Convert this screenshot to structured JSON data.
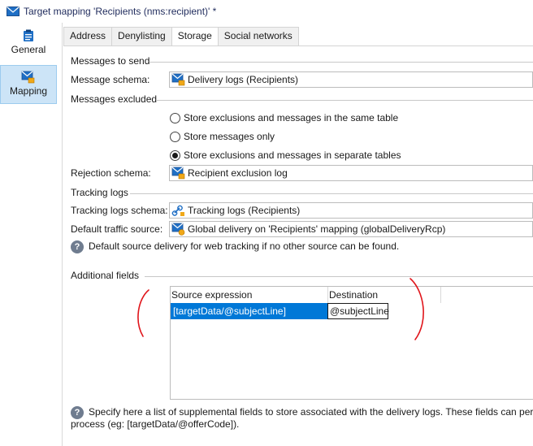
{
  "window": {
    "title": "Target mapping 'Recipients (nms:recipient)' *"
  },
  "nav": {
    "items": [
      {
        "label": "General",
        "icon": "clipboard-icon"
      },
      {
        "label": "Mapping",
        "icon": "mapping-icon",
        "selected": true
      }
    ]
  },
  "tabs": [
    {
      "label": "Address"
    },
    {
      "label": "Denylisting"
    },
    {
      "label": "Storage",
      "active": true
    },
    {
      "label": "Social networks"
    }
  ],
  "storage": {
    "messages_to_send": {
      "section_title": "Messages to send",
      "schema_label": "Message schema:",
      "schema_value": "Delivery logs (Recipients)"
    },
    "messages_excluded": {
      "section_title": "Messages excluded",
      "options": [
        {
          "label": "Store exclusions and messages in the same table",
          "checked": false
        },
        {
          "label": "Store messages only",
          "checked": false
        },
        {
          "label": "Store exclusions and messages in separate tables",
          "checked": true
        }
      ],
      "rejection_label": "Rejection schema:",
      "rejection_value": "Recipient exclusion log"
    },
    "tracking_logs": {
      "section_title": "Tracking logs",
      "schema_label": "Tracking logs schema:",
      "schema_value": "Tracking logs (Recipients)",
      "traffic_label": "Default traffic source:",
      "traffic_value": "Global delivery on 'Recipients' mapping (globalDeliveryRcp)",
      "help_text": "Default source delivery for web tracking if no other source can be found."
    },
    "additional_fields": {
      "section_title": "Additional fields",
      "columns": [
        "Source expression",
        "Destination"
      ],
      "rows": [
        {
          "source": "[targetData/@subjectLine]",
          "destination": "@subjectLine"
        }
      ],
      "help_line1": "Specify here a list of supplemental fields to store associated with the delivery logs. These fields can perm",
      "help_line2": "process (eg: [targetData/@offerCode])."
    }
  },
  "colors": {
    "accent": "#0078d7",
    "selected_nav": "#cce4f7",
    "annotation": "#e0151b"
  }
}
